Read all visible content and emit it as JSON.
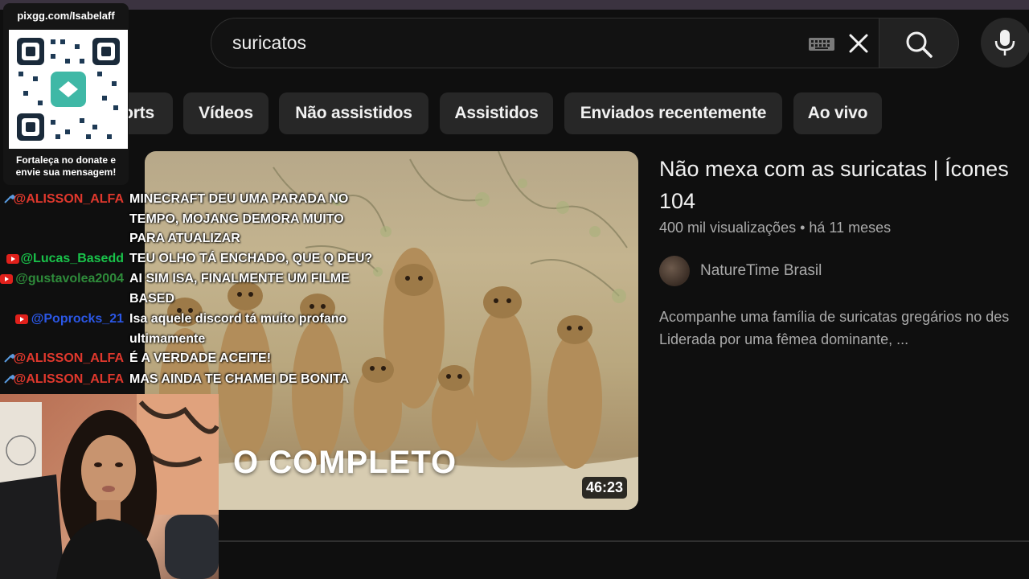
{
  "search": {
    "query": "suricatos"
  },
  "chips": [
    {
      "label": "orts"
    },
    {
      "label": "Vídeos"
    },
    {
      "label": "Não assistidos"
    },
    {
      "label": "Assistidos"
    },
    {
      "label": "Enviados recentemente"
    },
    {
      "label": "Ao vivo"
    }
  ],
  "video": {
    "thumbnail_text": "O COMPLETO",
    "duration": "46:23",
    "title": "Não mexa com as suricatas | Ícones\n104",
    "meta": "400 mil visualizações • há 11 meses",
    "channel": "NatureTime Brasil",
    "description": "Acompanhe uma família de suricatas gregários no des\nLiderada por uma fêmea dominante, ..."
  },
  "overlay": {
    "qr_url": "pixgg.com/Isabelaff",
    "qr_caption": "Fortaleça no donate e\nenvie sua mensagem!"
  },
  "chat": [
    {
      "user": "@ALISSON_ALFA",
      "message": "MINECRAFT DEU UMA PARADA NO TEMPO, MOJANG DEMORA MUITO PARA ATUALIZAR",
      "user_color": "#e0382d",
      "icon": "wrench-icon"
    },
    {
      "user": "@Lucas_Basedd",
      "message": "TEU OLHO TÁ ENCHADO, QUE Q DEU?",
      "user_color": "#19c24a",
      "icon": "youtube-icon"
    },
    {
      "user": "@gustavolea2004",
      "message": "AI SIM ISA, FINALMENTE UM FILME BASED",
      "user_color": "#2e8b3a",
      "icon": "youtube-icon"
    },
    {
      "user": "@Poprocks_21",
      "message": "Isa aquele discord tá muito profano ultimamente",
      "user_color": "#2b57e6",
      "icon": "youtube-icon"
    },
    {
      "user": "@ALISSON_ALFA",
      "message": "É A VERDADE ACEITE!",
      "user_color": "#e0382d",
      "icon": "wrench-icon"
    },
    {
      "user": "@ALISSON_ALFA",
      "message": "MAS AINDA TE CHAMEI DE BONITA",
      "user_color": "#e0382d",
      "icon": "wrench-icon"
    }
  ]
}
